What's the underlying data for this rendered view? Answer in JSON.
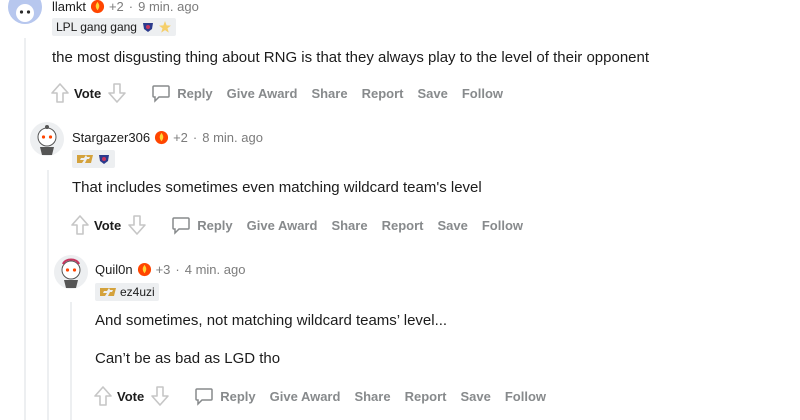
{
  "comments": [
    {
      "username": "llamkt",
      "score": "+2",
      "time": "9 min. ago",
      "flair": "LPL gang gang",
      "body": [
        "the most disgusting thing about RNG is that they always play to the level of their opponent"
      ]
    },
    {
      "username": "Stargazer306",
      "score": "+2",
      "time": "8 min. ago",
      "flair": "",
      "body": [
        "That includes sometimes even matching wildcard team's level"
      ]
    },
    {
      "username": "Quil0n",
      "score": "+3",
      "time": "4 min. ago",
      "flair": "ez4uzi",
      "body": [
        "And sometimes, not matching wildcard teams’ level...",
        "Can’t be as bad as LGD tho"
      ]
    }
  ],
  "actions": {
    "vote": "Vote",
    "reply": "Reply",
    "give_award": "Give Award",
    "share": "Share",
    "report": "Report",
    "save": "Save",
    "follow": "Follow"
  },
  "colors": {
    "muted": "#7c7c7c",
    "action": "#878a8c",
    "line": "#edeff1",
    "flair_bg": "#edeff1"
  }
}
